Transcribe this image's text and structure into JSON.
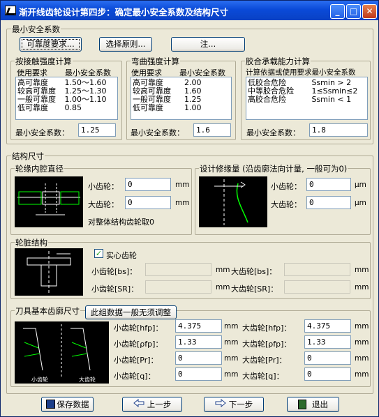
{
  "window": {
    "title": "渐开线齿轮设计第四步：确定最小安全系数及结构尺寸"
  },
  "safety": {
    "group_label": "最小安全系数",
    "btn_reliability": "可靠度要求...",
    "btn_principle": "选择原则...",
    "btn_note": "注...",
    "contact": {
      "title": "按接触强度计算",
      "col1": "使用要求",
      "col2": "最小安全系数",
      "rows": [
        [
          "高可靠度",
          "1.50～1.60"
        ],
        [
          "较高可靠度",
          "1.25～1.30"
        ],
        [
          "一般可靠度",
          "1.00～1.10"
        ],
        [
          "低可靠度",
          "0.85"
        ]
      ],
      "label": "最小安全系数：",
      "value": "1.25"
    },
    "bending": {
      "title": "弯曲强度计算",
      "col1": "使用要求",
      "col2": "最小安全系数",
      "rows": [
        [
          "高可靠度",
          "2.00"
        ],
        [
          "较高可靠度",
          "1.60"
        ],
        [
          "一般可靠度",
          "1.25"
        ],
        [
          "低可靠度",
          "1.00"
        ]
      ],
      "label": "最小安全系数：",
      "value": "1.6"
    },
    "glue": {
      "title": "胶合承载能力计算",
      "header": "计算依据或使用要求最小安全系数",
      "rows": [
        [
          "低胶合危险",
          "Ssmin  >  2"
        ],
        [
          "中等胶合危险",
          "1≤Ssmin≤2"
        ],
        [
          "高胶合危险",
          "Ssmin  <  1"
        ]
      ],
      "label": "最小安全系数：",
      "value": "1.8"
    }
  },
  "structure": {
    "group_label": "结构尺寸",
    "rim": {
      "title": "轮缘内腔直径",
      "small_label": "小齿轮：",
      "small_value": "0",
      "large_label": "大齿轮：",
      "large_value": "0",
      "unit": "mm",
      "note": "对整体结构齿轮取0"
    },
    "mod": {
      "title": "设计修缘量 (沿齿廓法向计量, 一般可为0)",
      "small_label": "小齿轮：",
      "small_value": "0",
      "large_label": "大齿轮：",
      "large_value": "0",
      "unit": "μm"
    },
    "hub": {
      "title": "轮脏结构",
      "solid_label": "实心齿轮",
      "solid_checked": "✓",
      "bs_small": "小齿轮[bs]：",
      "bs_large": "大齿轮[bs]：",
      "sr_small": "小齿轮[SR]：",
      "sr_large": "大齿轮[SR]：",
      "unit": "mm"
    },
    "tool": {
      "title": "刀具基本齿廓尺寸",
      "btn_label": "此组数据一般无须调整",
      "fig1_caption": "小齿轮",
      "fig2_caption": "大齿轮",
      "rows": [
        {
          "l1": "小齿轮[hfp]：",
          "v1": "4.375",
          "l2": "大齿轮[hfp]：",
          "v2": "4.375"
        },
        {
          "l1": "小齿轮[ρfp]：",
          "v1": "1.33",
          "l2": "大齿轮[ρfp]：",
          "v2": "1.33"
        },
        {
          "l1": "小齿轮[Pr]：",
          "v1": "0",
          "l2": "大齿轮[Pr]：",
          "v2": "0"
        },
        {
          "l1": "小齿轮[q]：",
          "v1": "0",
          "l2": "大齿轮[q]：",
          "v2": "0"
        }
      ],
      "unit": "mm"
    }
  },
  "footer": {
    "save": "保存数据",
    "prev": "上一步",
    "next": "下一步",
    "exit": "退出"
  }
}
